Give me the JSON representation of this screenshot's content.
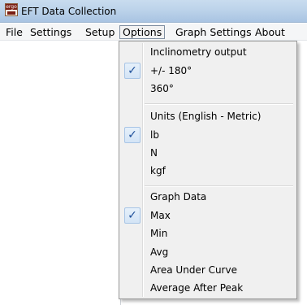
{
  "window": {
    "title": "EFT Data Collection",
    "icon": "ergo-app-icon",
    "icon_text": "ergo"
  },
  "menubar": {
    "items": [
      "File",
      "Settings",
      "Setup",
      "Options",
      "Graph Settings",
      "About"
    ],
    "active": "Options"
  },
  "options_menu": {
    "inclinometry": {
      "header": "Inclinometry output",
      "items": [
        {
          "label": "+/- 180°",
          "checked": true
        },
        {
          "label": "360°",
          "checked": false
        }
      ]
    },
    "units": {
      "header": "Units (English - Metric)",
      "items": [
        {
          "label": "lb",
          "checked": true
        },
        {
          "label": "N",
          "checked": false
        },
        {
          "label": "kgf",
          "checked": false
        }
      ]
    },
    "graph_data": {
      "header": "Graph Data",
      "items": [
        {
          "label": "Max",
          "checked": true
        },
        {
          "label": "Min",
          "checked": false
        },
        {
          "label": "Avg",
          "checked": false
        },
        {
          "label": "Area Under Curve",
          "checked": false
        },
        {
          "label": "Average After Peak",
          "checked": false
        }
      ]
    },
    "check_glyph": "✓"
  },
  "colors": {
    "titlebar": "#bcd3ea",
    "menu_background": "#f0f0f0",
    "check_color": "#1d4f9a"
  }
}
